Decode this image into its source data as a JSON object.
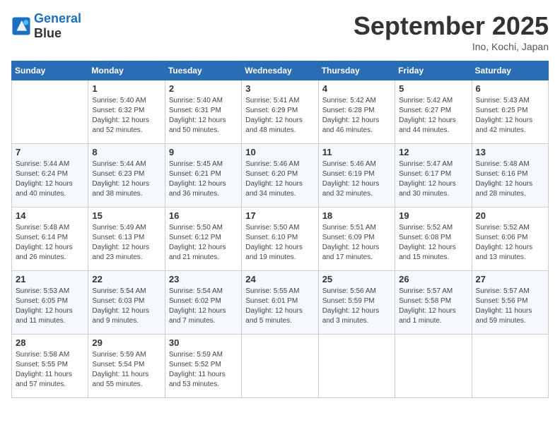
{
  "header": {
    "logo_line1": "General",
    "logo_line2": "Blue",
    "month_title": "September 2025",
    "subtitle": "Ino, Kochi, Japan"
  },
  "weekdays": [
    "Sunday",
    "Monday",
    "Tuesday",
    "Wednesday",
    "Thursday",
    "Friday",
    "Saturday"
  ],
  "weeks": [
    [
      {
        "day": "",
        "sunrise": "",
        "sunset": "",
        "daylight": ""
      },
      {
        "day": "1",
        "sunrise": "Sunrise: 5:40 AM",
        "sunset": "Sunset: 6:32 PM",
        "daylight": "Daylight: 12 hours and 52 minutes."
      },
      {
        "day": "2",
        "sunrise": "Sunrise: 5:40 AM",
        "sunset": "Sunset: 6:31 PM",
        "daylight": "Daylight: 12 hours and 50 minutes."
      },
      {
        "day": "3",
        "sunrise": "Sunrise: 5:41 AM",
        "sunset": "Sunset: 6:29 PM",
        "daylight": "Daylight: 12 hours and 48 minutes."
      },
      {
        "day": "4",
        "sunrise": "Sunrise: 5:42 AM",
        "sunset": "Sunset: 6:28 PM",
        "daylight": "Daylight: 12 hours and 46 minutes."
      },
      {
        "day": "5",
        "sunrise": "Sunrise: 5:42 AM",
        "sunset": "Sunset: 6:27 PM",
        "daylight": "Daylight: 12 hours and 44 minutes."
      },
      {
        "day": "6",
        "sunrise": "Sunrise: 5:43 AM",
        "sunset": "Sunset: 6:25 PM",
        "daylight": "Daylight: 12 hours and 42 minutes."
      }
    ],
    [
      {
        "day": "7",
        "sunrise": "Sunrise: 5:44 AM",
        "sunset": "Sunset: 6:24 PM",
        "daylight": "Daylight: 12 hours and 40 minutes."
      },
      {
        "day": "8",
        "sunrise": "Sunrise: 5:44 AM",
        "sunset": "Sunset: 6:23 PM",
        "daylight": "Daylight: 12 hours and 38 minutes."
      },
      {
        "day": "9",
        "sunrise": "Sunrise: 5:45 AM",
        "sunset": "Sunset: 6:21 PM",
        "daylight": "Daylight: 12 hours and 36 minutes."
      },
      {
        "day": "10",
        "sunrise": "Sunrise: 5:46 AM",
        "sunset": "Sunset: 6:20 PM",
        "daylight": "Daylight: 12 hours and 34 minutes."
      },
      {
        "day": "11",
        "sunrise": "Sunrise: 5:46 AM",
        "sunset": "Sunset: 6:19 PM",
        "daylight": "Daylight: 12 hours and 32 minutes."
      },
      {
        "day": "12",
        "sunrise": "Sunrise: 5:47 AM",
        "sunset": "Sunset: 6:17 PM",
        "daylight": "Daylight: 12 hours and 30 minutes."
      },
      {
        "day": "13",
        "sunrise": "Sunrise: 5:48 AM",
        "sunset": "Sunset: 6:16 PM",
        "daylight": "Daylight: 12 hours and 28 minutes."
      }
    ],
    [
      {
        "day": "14",
        "sunrise": "Sunrise: 5:48 AM",
        "sunset": "Sunset: 6:14 PM",
        "daylight": "Daylight: 12 hours and 26 minutes."
      },
      {
        "day": "15",
        "sunrise": "Sunrise: 5:49 AM",
        "sunset": "Sunset: 6:13 PM",
        "daylight": "Daylight: 12 hours and 23 minutes."
      },
      {
        "day": "16",
        "sunrise": "Sunrise: 5:50 AM",
        "sunset": "Sunset: 6:12 PM",
        "daylight": "Daylight: 12 hours and 21 minutes."
      },
      {
        "day": "17",
        "sunrise": "Sunrise: 5:50 AM",
        "sunset": "Sunset: 6:10 PM",
        "daylight": "Daylight: 12 hours and 19 minutes."
      },
      {
        "day": "18",
        "sunrise": "Sunrise: 5:51 AM",
        "sunset": "Sunset: 6:09 PM",
        "daylight": "Daylight: 12 hours and 17 minutes."
      },
      {
        "day": "19",
        "sunrise": "Sunrise: 5:52 AM",
        "sunset": "Sunset: 6:08 PM",
        "daylight": "Daylight: 12 hours and 15 minutes."
      },
      {
        "day": "20",
        "sunrise": "Sunrise: 5:52 AM",
        "sunset": "Sunset: 6:06 PM",
        "daylight": "Daylight: 12 hours and 13 minutes."
      }
    ],
    [
      {
        "day": "21",
        "sunrise": "Sunrise: 5:53 AM",
        "sunset": "Sunset: 6:05 PM",
        "daylight": "Daylight: 12 hours and 11 minutes."
      },
      {
        "day": "22",
        "sunrise": "Sunrise: 5:54 AM",
        "sunset": "Sunset: 6:03 PM",
        "daylight": "Daylight: 12 hours and 9 minutes."
      },
      {
        "day": "23",
        "sunrise": "Sunrise: 5:54 AM",
        "sunset": "Sunset: 6:02 PM",
        "daylight": "Daylight: 12 hours and 7 minutes."
      },
      {
        "day": "24",
        "sunrise": "Sunrise: 5:55 AM",
        "sunset": "Sunset: 6:01 PM",
        "daylight": "Daylight: 12 hours and 5 minutes."
      },
      {
        "day": "25",
        "sunrise": "Sunrise: 5:56 AM",
        "sunset": "Sunset: 5:59 PM",
        "daylight": "Daylight: 12 hours and 3 minutes."
      },
      {
        "day": "26",
        "sunrise": "Sunrise: 5:57 AM",
        "sunset": "Sunset: 5:58 PM",
        "daylight": "Daylight: 12 hours and 1 minute."
      },
      {
        "day": "27",
        "sunrise": "Sunrise: 5:57 AM",
        "sunset": "Sunset: 5:56 PM",
        "daylight": "Daylight: 11 hours and 59 minutes."
      }
    ],
    [
      {
        "day": "28",
        "sunrise": "Sunrise: 5:58 AM",
        "sunset": "Sunset: 5:55 PM",
        "daylight": "Daylight: 11 hours and 57 minutes."
      },
      {
        "day": "29",
        "sunrise": "Sunrise: 5:59 AM",
        "sunset": "Sunset: 5:54 PM",
        "daylight": "Daylight: 11 hours and 55 minutes."
      },
      {
        "day": "30",
        "sunrise": "Sunrise: 5:59 AM",
        "sunset": "Sunset: 5:52 PM",
        "daylight": "Daylight: 11 hours and 53 minutes."
      },
      {
        "day": "",
        "sunrise": "",
        "sunset": "",
        "daylight": ""
      },
      {
        "day": "",
        "sunrise": "",
        "sunset": "",
        "daylight": ""
      },
      {
        "day": "",
        "sunrise": "",
        "sunset": "",
        "daylight": ""
      },
      {
        "day": "",
        "sunrise": "",
        "sunset": "",
        "daylight": ""
      }
    ]
  ]
}
